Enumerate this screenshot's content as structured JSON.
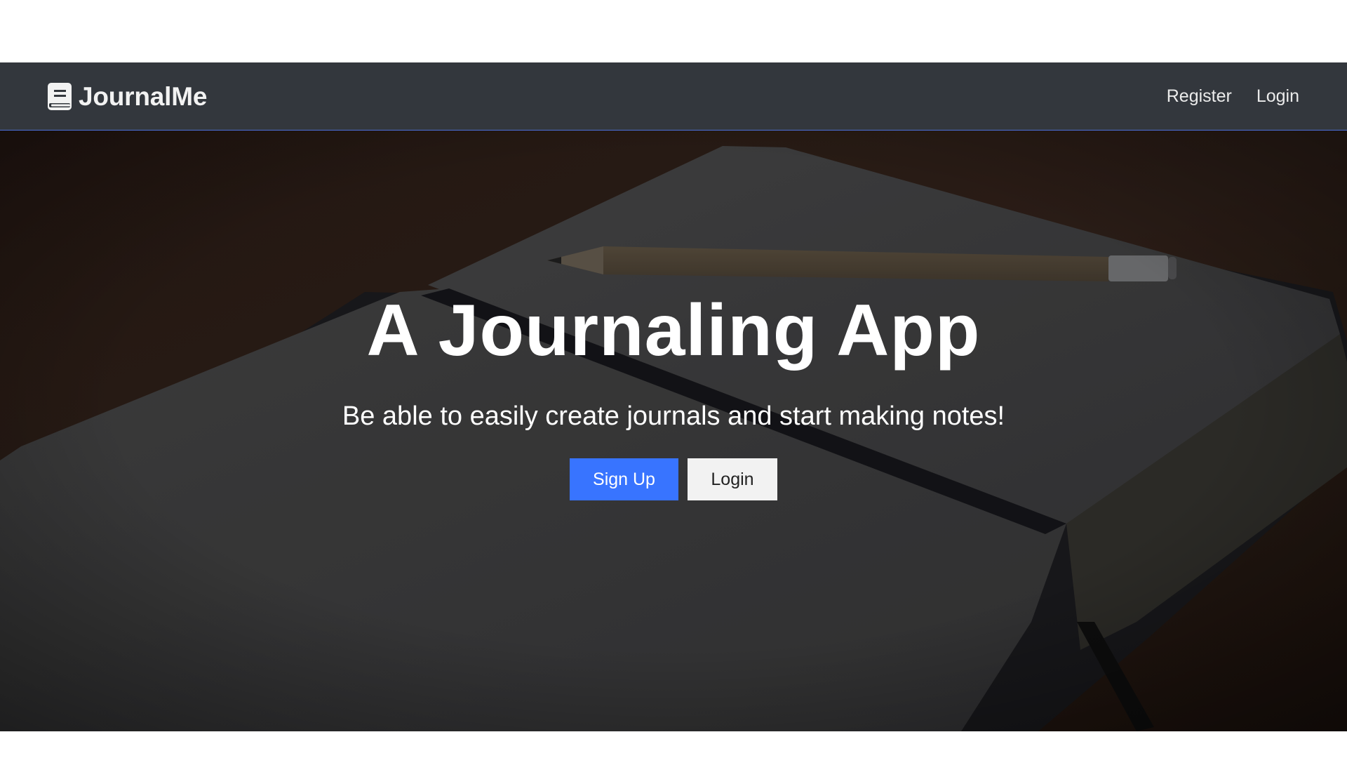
{
  "navbar": {
    "brand": {
      "icon": "book-icon",
      "text": "JournalMe"
    },
    "links": {
      "register": "Register",
      "login": "Login"
    }
  },
  "hero": {
    "background": "open-notebook-with-pencil-image",
    "title": "A Journaling App",
    "subtitle": "Be able to easily create journals and start making notes!",
    "buttons": {
      "signup": "Sign Up",
      "login": "Login"
    }
  },
  "colors": {
    "navbar_bg": "#33373d",
    "navbar_border": "#4c6fd8",
    "primary": "#3874ff",
    "light_button": "#f2f2f2"
  }
}
